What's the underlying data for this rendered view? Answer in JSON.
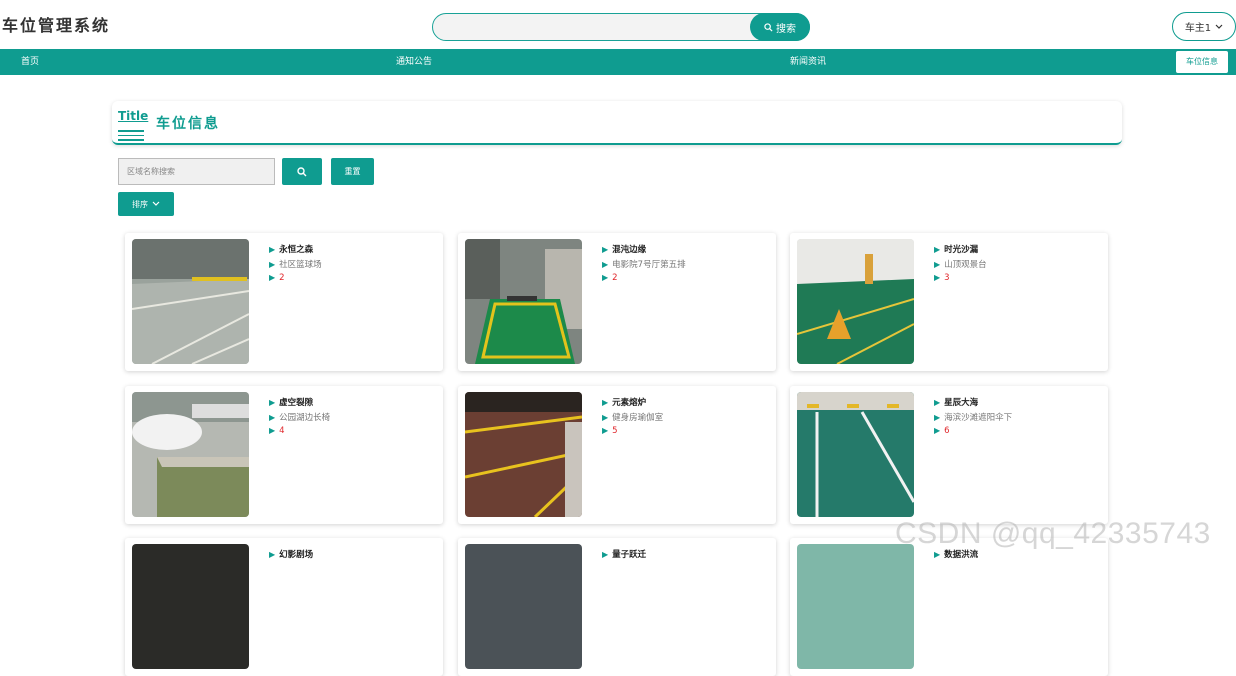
{
  "app": {
    "title": "车位管理系统"
  },
  "search": {
    "button_label": "搜索",
    "placeholder": ""
  },
  "user": {
    "label": "车主1"
  },
  "nav": {
    "items": [
      {
        "label": "首页"
      },
      {
        "label": "通知公告"
      },
      {
        "label": "新闻资讯"
      },
      {
        "label": "车位信息"
      }
    ]
  },
  "section": {
    "title_word": "Title",
    "title": "车位信息"
  },
  "filter": {
    "placeholder": "区域名称搜索",
    "reset_label": "重置",
    "sort_label": "排序"
  },
  "cards": [
    {
      "name": "永恒之森",
      "location": "社区篮球场",
      "count": "2"
    },
    {
      "name": "混沌边缘",
      "location": "电影院7号厅第五排",
      "count": "2"
    },
    {
      "name": "时光沙漏",
      "location": "山顶观景台",
      "count": "3"
    },
    {
      "name": "虚空裂隙",
      "location": "公园湖边长椅",
      "count": "4"
    },
    {
      "name": "元素熔炉",
      "location": "健身房瑜伽室",
      "count": "5"
    },
    {
      "name": "星辰大海",
      "location": "海滨沙滩遮阳伞下",
      "count": "6"
    },
    {
      "name": "幻影剧场",
      "location": "",
      "count": ""
    },
    {
      "name": "量子跃迁",
      "location": "",
      "count": ""
    },
    {
      "name": "数据洪流",
      "location": "",
      "count": ""
    }
  ],
  "watermark": "CSDN @qq_42335743",
  "colors": {
    "accent": "#0f9c90",
    "count": "#e0262b"
  }
}
